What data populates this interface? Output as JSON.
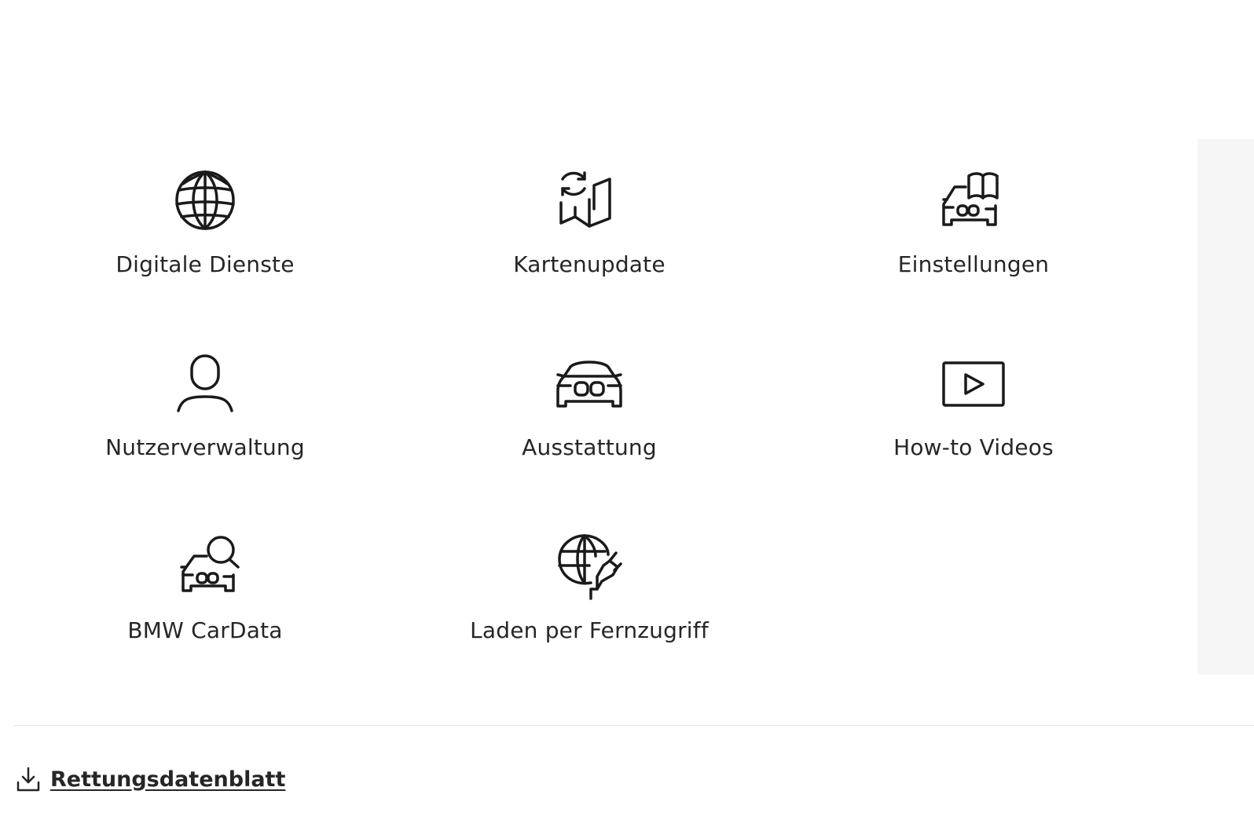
{
  "tiles": [
    {
      "label": "Digitale Dienste",
      "icon": "globe-icon"
    },
    {
      "label": "Kartenupdate",
      "icon": "map-update-icon"
    },
    {
      "label": "Einstellungen",
      "icon": "car-manual-icon"
    },
    {
      "label": "Nutzerverwaltung",
      "icon": "user-icon"
    },
    {
      "label": "Ausstattung",
      "icon": "car-front-icon"
    },
    {
      "label": "How-to Videos",
      "icon": "video-play-icon"
    },
    {
      "label": "BMW CarData",
      "icon": "car-search-icon"
    },
    {
      "label": "Laden per Fernzugriff",
      "icon": "globe-plug-icon"
    }
  ],
  "footer": {
    "download_label": "Rettungsdatenblatt",
    "download_icon": "download-icon"
  },
  "colors": {
    "text": "#262626",
    "icon_stroke": "#1a1a1a",
    "divider": "#e4e4e4",
    "side_panel": "#f6f6f6"
  }
}
